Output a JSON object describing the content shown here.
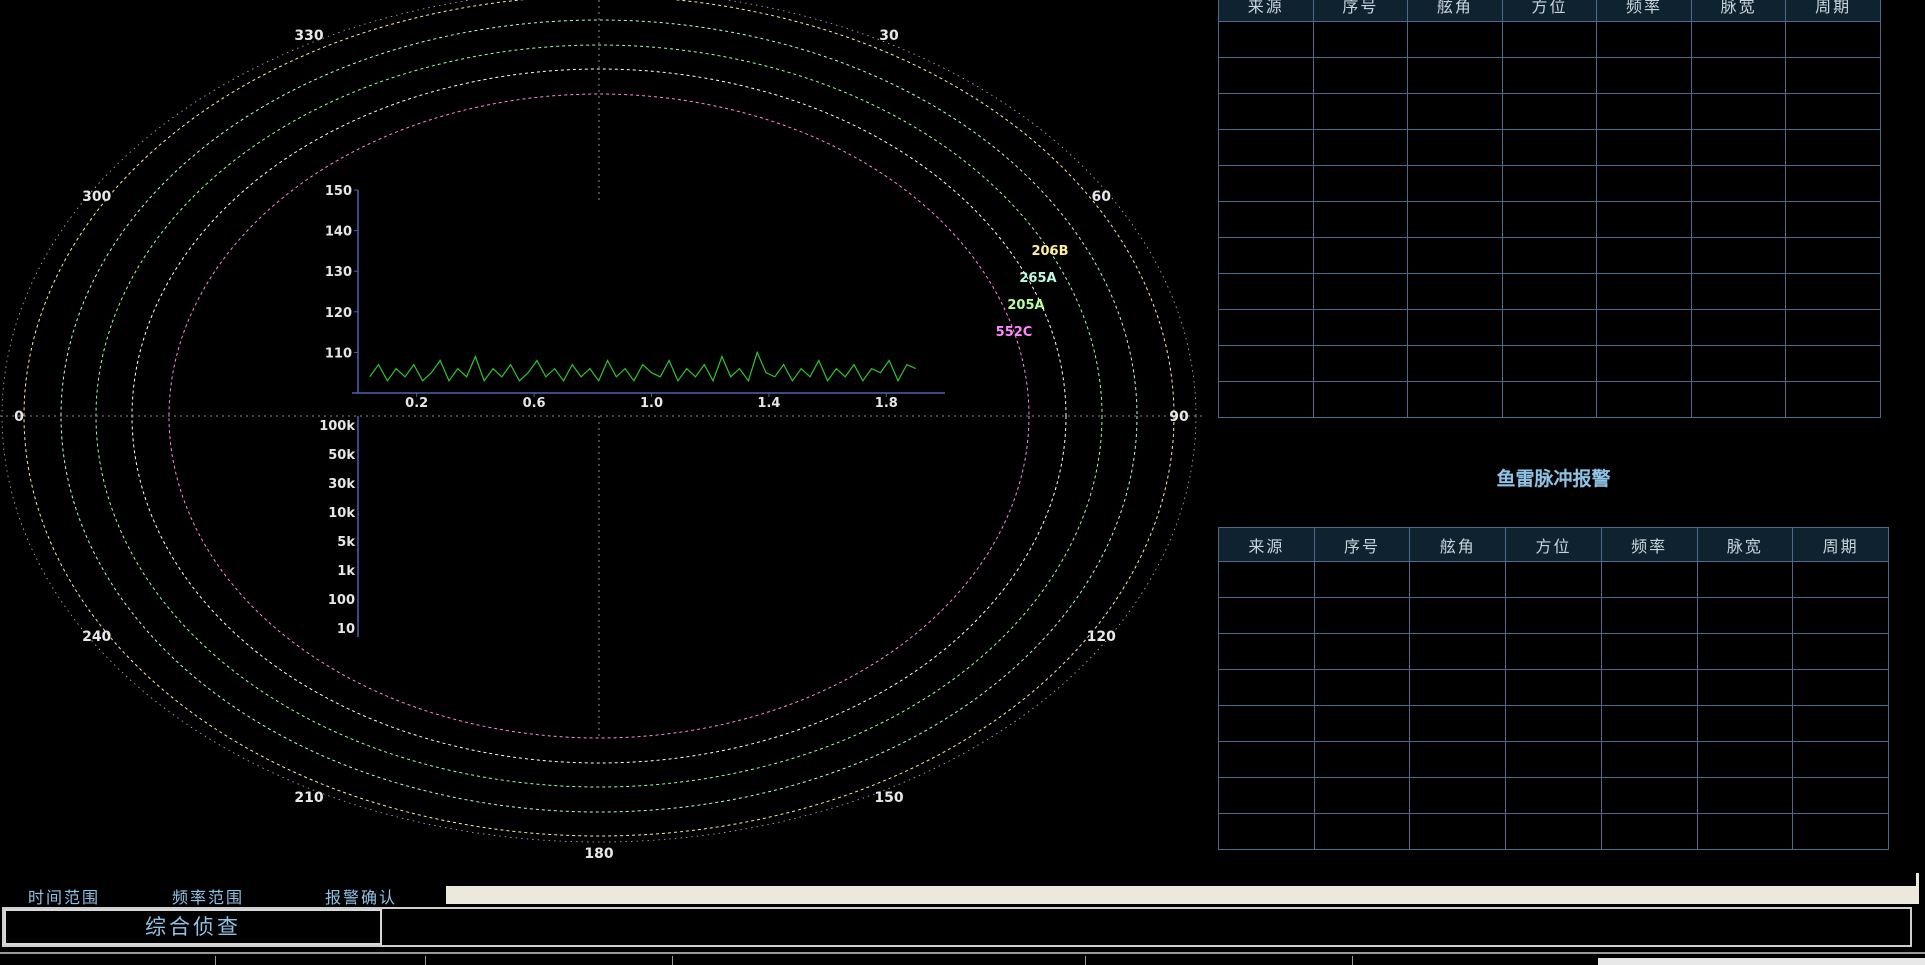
{
  "polar_plot": {
    "bearing_labels": [
      {
        "deg": 0,
        "text": ""
      },
      {
        "deg": 30,
        "text": "30"
      },
      {
        "deg": 60,
        "text": "60"
      },
      {
        "deg": 90,
        "text": "90"
      },
      {
        "deg": 120,
        "text": "120"
      },
      {
        "deg": 150,
        "text": "150"
      },
      {
        "deg": 180,
        "text": "180"
      },
      {
        "deg": 210,
        "text": "210"
      },
      {
        "deg": 240,
        "text": "240"
      },
      {
        "deg": 270,
        "text": "0"
      },
      {
        "deg": 300,
        "text": "300"
      },
      {
        "deg": 330,
        "text": "330"
      }
    ],
    "ring_colors": [
      "#ff8ad8",
      "#ffffff",
      "#9dffa3",
      "#b0ffdc",
      "#ffe9a6",
      "#b8b8b8"
    ],
    "targets": [
      {
        "label": "206B",
        "color": "#ffee9a"
      },
      {
        "label": "265A",
        "color": "#bdfce8"
      },
      {
        "label": "205A",
        "color": "#b6ff9a"
      },
      {
        "label": "552C",
        "color": "#ff88ff"
      }
    ]
  },
  "chart_data": [
    {
      "type": "line",
      "x_ticks": [
        "0.2",
        "0.6",
        "1.0",
        "1.4",
        "1.8"
      ],
      "y_ticks": [
        "110",
        "120",
        "130",
        "140",
        "150"
      ],
      "ylim": [
        100,
        150
      ],
      "xlim": [
        0,
        2.0
      ],
      "series": [
        {
          "color": "#2ec42e",
          "x": [
            0.04,
            0.07,
            0.1,
            0.13,
            0.16,
            0.19,
            0.22,
            0.25,
            0.28,
            0.31,
            0.34,
            0.37,
            0.4,
            0.43,
            0.46,
            0.49,
            0.52,
            0.55,
            0.58,
            0.61,
            0.64,
            0.67,
            0.7,
            0.73,
            0.76,
            0.79,
            0.82,
            0.85,
            0.88,
            0.91,
            0.94,
            0.97,
            1.0,
            1.03,
            1.06,
            1.09,
            1.12,
            1.15,
            1.18,
            1.21,
            1.24,
            1.27,
            1.3,
            1.33,
            1.36,
            1.39,
            1.42,
            1.45,
            1.48,
            1.51,
            1.54,
            1.57,
            1.6,
            1.63,
            1.66,
            1.69,
            1.72,
            1.75,
            1.78,
            1.81,
            1.84,
            1.87,
            1.9
          ],
          "y": [
            104,
            107,
            103,
            106,
            104,
            107,
            103,
            105,
            108,
            103,
            106,
            104,
            109,
            103,
            106,
            104,
            107,
            103,
            105,
            108,
            104,
            106,
            103,
            107,
            104,
            106,
            103,
            108,
            104,
            106,
            103,
            107,
            105,
            104,
            108,
            103,
            106,
            104,
            107,
            103,
            109,
            104,
            106,
            103,
            110,
            105,
            104,
            107,
            103,
            106,
            104,
            108,
            103,
            106,
            104,
            107,
            103,
            106,
            105,
            108,
            103,
            107,
            106
          ]
        }
      ]
    },
    {
      "type": "axis",
      "y_ticks": [
        "100k",
        "50k",
        "30k",
        "10k",
        "5k",
        "1k",
        "100",
        "10"
      ]
    }
  ],
  "table_top": {
    "headers": [
      "来源",
      "序号",
      "舷角",
      "方位",
      "频率",
      "脉宽",
      "周期"
    ],
    "rows": 11
  },
  "alarm": {
    "title": "鱼雷脉冲报警",
    "headers": [
      "来源",
      "序号",
      "舷角",
      "方位",
      "频率",
      "脉宽",
      "周期"
    ],
    "rows": 8
  },
  "controls": {
    "time_range": "时间范围",
    "freq_range": "频率范围",
    "alarm_confirm": "报警确认",
    "mode_button": "综合侦查"
  }
}
